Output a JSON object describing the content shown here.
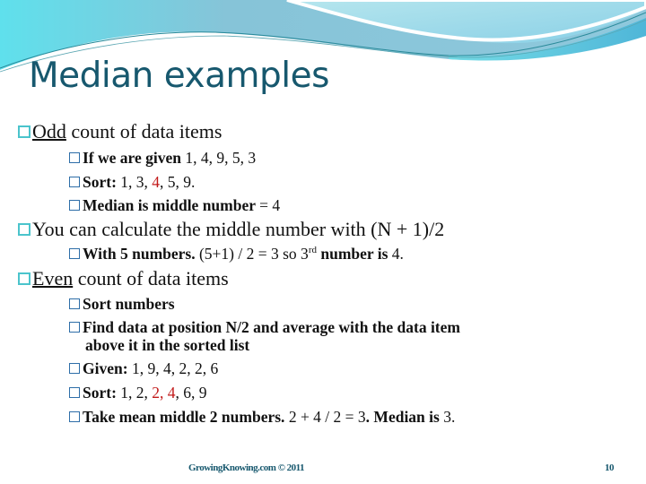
{
  "slide": {
    "title": "Median examples",
    "colors": {
      "title": "#17586e",
      "bullet_level1": "#4bc4cc",
      "bullet_level2": "#2e6ea8",
      "highlight": "#c21a1a",
      "banner_light": "#a8dde8",
      "banner_mid": "#7fc6d8",
      "banner_cyan": "#5fd8e6"
    },
    "sections": [
      {
        "heading_underlined": "Odd",
        "heading_rest": " count of data items",
        "items": [
          {
            "text": "If we are given ",
            "values": "1, 4, 9, 5, 3"
          },
          {
            "text": "Sort: ",
            "before": " 1, 3, ",
            "highlight": "4",
            "after": ", 5, 9."
          },
          {
            "text": "Median is middle number ",
            "values": "= 4"
          }
        ]
      },
      {
        "heading": "You can calculate the middle number with (N + 1)/2",
        "items": [
          {
            "text": "With 5 numbers. ",
            "formula": " (5+1) / 2 = 3 so 3",
            "superscript": "rd",
            "text2": " number is ",
            "value": "4."
          }
        ]
      },
      {
        "heading_underlined": "Even",
        "heading_rest": " count of data items",
        "items": [
          {
            "text": "Sort numbers"
          },
          {
            "text": "Find data at position N/2 and average with the data item",
            "continuation": "above it in the sorted list"
          },
          {
            "text": "Given: ",
            "values": " 1, 9, 4, 2, 2, 6"
          },
          {
            "text": "Sort: ",
            "before": "1, 2, ",
            "highlight": "2, 4",
            "after": ", 6, 9"
          },
          {
            "text": "Take mean middle 2 numbers. ",
            "values": " 2 + 4 / 2 = 3",
            "text2": ". Median is ",
            "value": "3."
          }
        ]
      }
    ],
    "footer": {
      "credit": "GrowingKnowing.com  © 2011",
      "page_number": "10"
    }
  }
}
